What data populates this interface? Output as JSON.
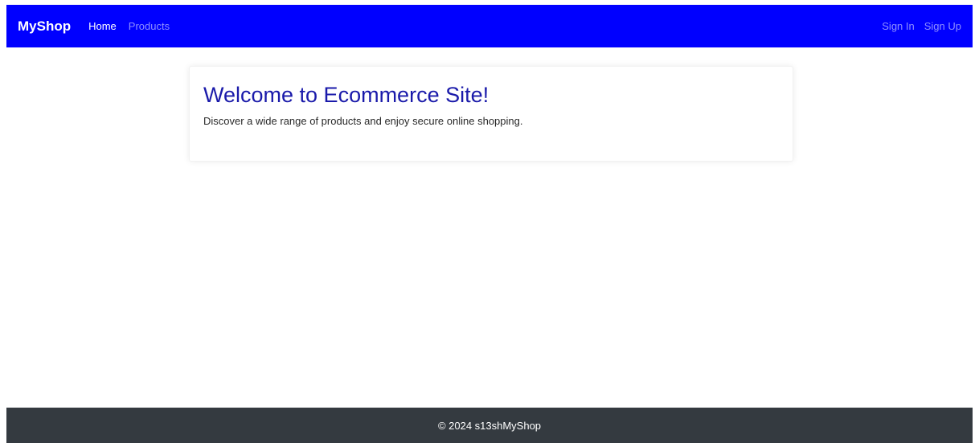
{
  "navbar": {
    "brand": "MyShop",
    "links": [
      {
        "label": "Home",
        "active": true
      },
      {
        "label": "Products",
        "active": false
      }
    ],
    "auth": [
      {
        "label": "Sign In"
      },
      {
        "label": "Sign Up"
      }
    ],
    "background_color": "#0000ff"
  },
  "main": {
    "title": "Welcome to Ecommerce Site!",
    "description": "Discover a wide range of products and enjoy secure online shopping.",
    "title_color": "#1a1aaa"
  },
  "footer": {
    "text": "© 2024 s13shMyShop",
    "background_color": "#343a40"
  }
}
